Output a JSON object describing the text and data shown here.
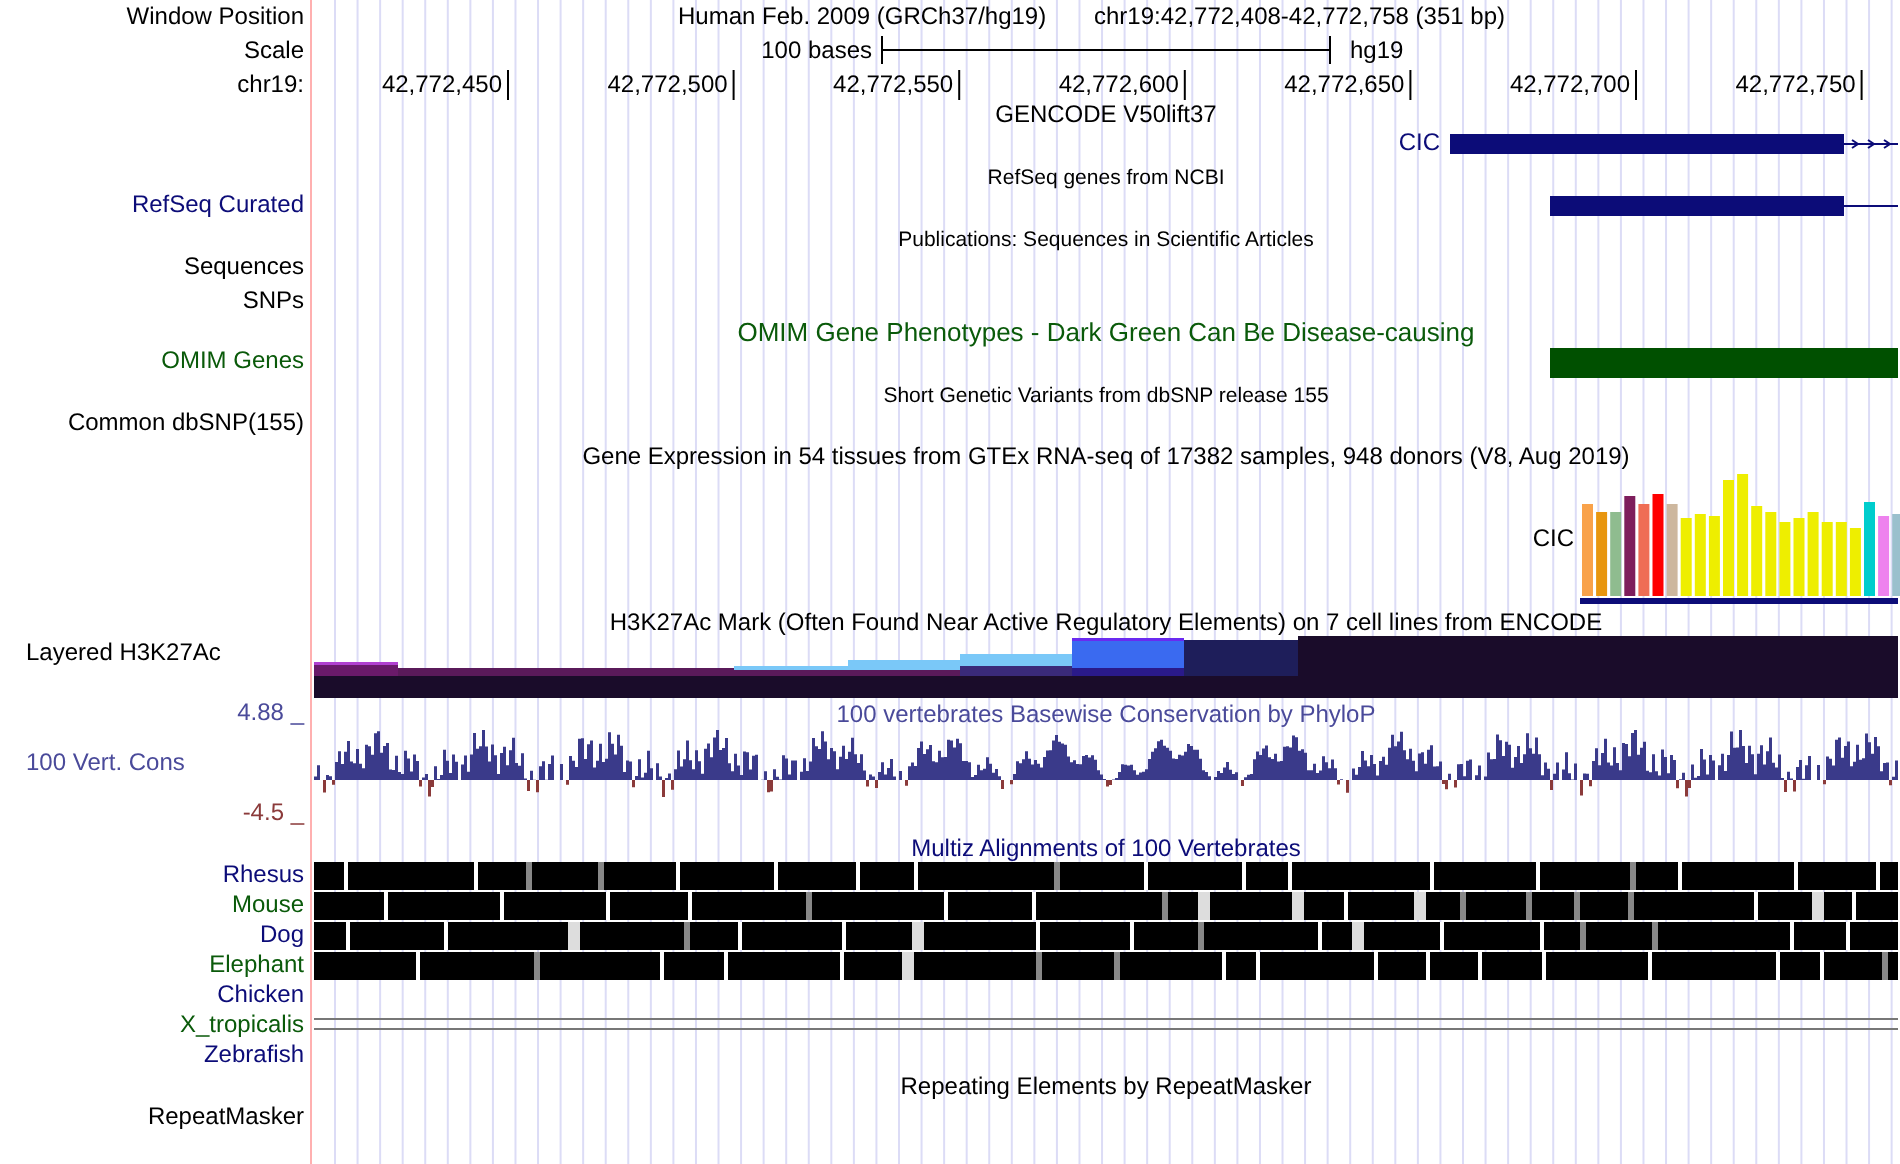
{
  "header": {
    "row_label": "Window Position",
    "assembly": "Human Feb. 2009 (GRCh37/hg19)",
    "position": "chr19:42,772,408-42,772,758 (351 bp)"
  },
  "scale": {
    "label": "Scale",
    "bar_label": "100 bases",
    "db": "hg19"
  },
  "ruler": {
    "label": "chr19:",
    "ticks": [
      "42,772,450",
      "42,772,500",
      "42,772,550",
      "42,772,600",
      "42,772,650",
      "42,772,700",
      "42,772,750"
    ]
  },
  "tracks": [
    {
      "kind": "gencode",
      "title": "GENCODE V50lift37",
      "gene": "CIC"
    },
    {
      "kind": "refseq",
      "title": "RefSeq genes from NCBI",
      "label": "RefSeq Curated"
    },
    {
      "kind": "pubs",
      "title": "Publications: Sequences in Scientific Articles",
      "labels": [
        "Sequences",
        "SNPs"
      ]
    },
    {
      "kind": "omim",
      "title": "OMIM Gene Phenotypes - Dark Green Can Be Disease-causing",
      "label": "OMIM Genes"
    },
    {
      "kind": "dbsnp",
      "title": "Short Genetic Variants from dbSNP release 155",
      "label": "Common dbSNP(155)"
    },
    {
      "kind": "gtex",
      "title": "Gene Expression in 54 tissues from GTEx RNA-seq of 17382 samples, 948 donors (V8, Aug 2019)",
      "gene": "CIC"
    },
    {
      "kind": "h3k27ac",
      "title": "H3K27Ac Mark (Often Found Near Active Regulatory Elements) on 7 cell lines from ENCODE",
      "label": "Layered H3K27Ac"
    },
    {
      "kind": "phylop",
      "title": "100 vertebrates Basewise Conservation by PhyloP",
      "label": "100 Vert. Cons",
      "max": "4.88 _",
      "min": "-4.5 _"
    },
    {
      "kind": "multiz",
      "title": "Multiz Alignments of 100 Vertebrates",
      "species": [
        {
          "name": "Rhesus",
          "kind": "blocks"
        },
        {
          "name": "Mouse",
          "kind": "blocks"
        },
        {
          "name": "Dog",
          "kind": "blocks"
        },
        {
          "name": "Elephant",
          "kind": "blocks"
        },
        {
          "name": "Chicken",
          "kind": "none"
        },
        {
          "name": "X_tropicalis",
          "kind": "double-line"
        },
        {
          "name": "Zebrafish",
          "kind": "none"
        }
      ]
    },
    {
      "kind": "repeatmasker",
      "title": "Repeating Elements by RepeatMasker",
      "label": "RepeatMasker"
    }
  ]
}
